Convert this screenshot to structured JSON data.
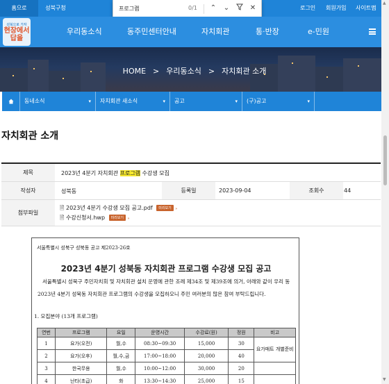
{
  "topbar": {
    "home_tab": "홈으로",
    "district_tab": "성북구청",
    "login": "로그인",
    "signup": "회원가입",
    "sitemap": "사이트맵"
  },
  "findbar": {
    "query": "프로그램",
    "count": "0/1"
  },
  "logo": {
    "small": "성북으로 가자",
    "big1": "현장에서",
    "big2": "답을"
  },
  "mainnav": {
    "items": [
      "우리동소식",
      "동주민센터안내",
      "자치회관",
      "통·반장",
      "e-민원"
    ]
  },
  "breadcrumb": {
    "home": "HOME",
    "sep": ">",
    "section": "우리동소식",
    "page": "자치회관 소개"
  },
  "subnav": {
    "items": [
      "동네소식",
      "자치회관 새소식",
      "공고",
      "(구)공고"
    ]
  },
  "page_title": "자치회관 소개",
  "post": {
    "title_label": "제목",
    "title_pre": "2023년 4분기 자치회관 ",
    "title_highlight": "프로그램",
    "title_post": " 수강생 모집",
    "author_label": "작성자",
    "author": "성북동",
    "date_label": "등록일",
    "date": "2023-09-04",
    "views_label": "조회수",
    "views": "44",
    "attach_label": "첨부파일",
    "attachments": [
      {
        "name": "2023년 4분기 수강생 모집 공고.pdf",
        "button": "미리보기"
      },
      {
        "name": "수강신청서.hwp",
        "button": "미리보기"
      }
    ]
  },
  "document": {
    "header": "서울특별시 성북구 성북동 공고 제2023-26호",
    "title": "2023년 4분기 성북동 자치회관 프로그램 수강생 모집 공고",
    "body": "서울특별시 성북구 주민자치회 및 자치회관 설치 운영에 관한 조례 제34조 및 제39조에 의거, 아래와 같이 우리 동 2023년 4분기 성북동 자치회관 프로그램의 수강생을 모집하오니 주민 여러분의 많은 참여 부탁드립니다.",
    "section": "1. 모집분야 (13개 프로그램)",
    "columns": [
      "연번",
      "프로그램",
      "요일",
      "운영시간",
      "수강료(원)",
      "정원",
      "비고"
    ],
    "rows": [
      [
        "1",
        "요가(오전)",
        "월,수",
        "08:30~09:30",
        "15,000",
        "30",
        ""
      ],
      [
        "2",
        "요가(오후)",
        "월,수,금",
        "17:00~18:00",
        "20,000",
        "40",
        ""
      ],
      [
        "3",
        "한국무용",
        "월,수",
        "10:00~12:00",
        "30,000",
        "20",
        ""
      ],
      [
        "4",
        "난타(초급)",
        "화",
        "13:30~14:30",
        "25,000",
        "15",
        ""
      ]
    ],
    "note": "요가매트 개별준비"
  }
}
